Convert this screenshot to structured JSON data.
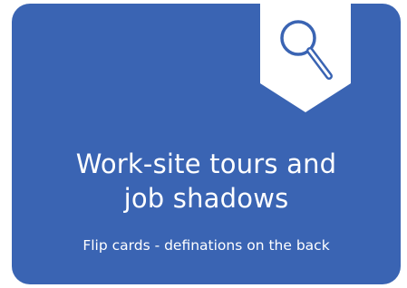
{
  "card": {
    "title_line1": "Work-site tours and",
    "title_line2": "job shadows",
    "subtitle": "Flip cards - definations on the back",
    "background_color": "#3a64b3",
    "icon": "magnifying-glass-icon"
  }
}
